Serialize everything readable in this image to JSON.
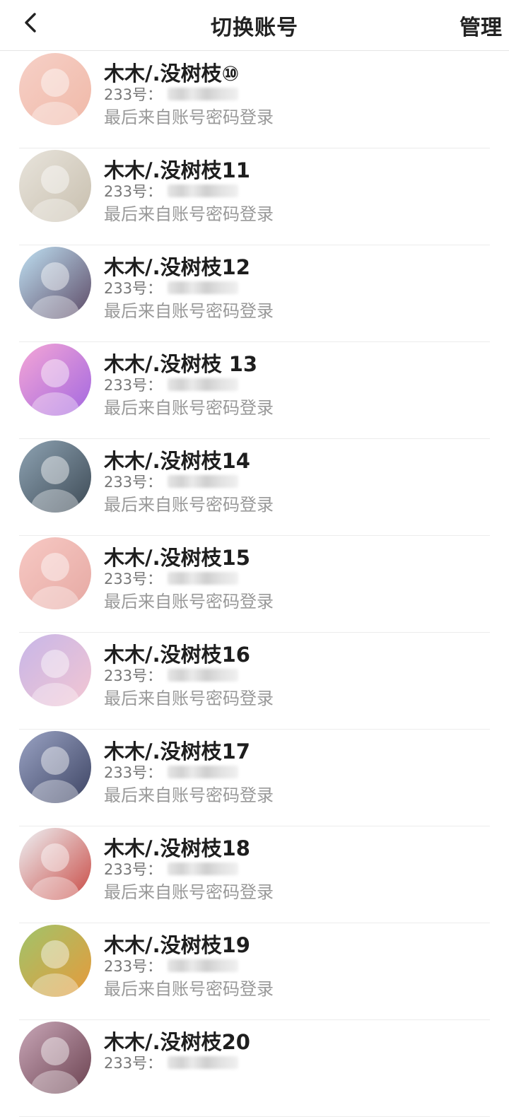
{
  "header": {
    "title": "切换账号",
    "manage_label": "管理",
    "back_icon": "chevron-left-icon"
  },
  "accounts": [
    {
      "name": "木木/.没树枝⑩",
      "id_label": "233号：",
      "login_info": "最后来自账号密码登录",
      "avatar_colors": [
        "#f6d0c7",
        "#f0b9a8"
      ]
    },
    {
      "name": "木木/.没树枝11",
      "id_label": "233号：",
      "login_info": "最后来自账号密码登录",
      "avatar_colors": [
        "#e8e4dc",
        "#c8bfae"
      ]
    },
    {
      "name": "木木/.没树枝12",
      "id_label": "233号：",
      "login_info": "最后来自账号密码登录",
      "avatar_colors": [
        "#bfe1f3",
        "#5d4a66"
      ]
    },
    {
      "name": "木木/.没树枝 13",
      "id_label": "233号：",
      "login_info": "最后来自账号密码登录",
      "avatar_colors": [
        "#f5a6d6",
        "#a368e0"
      ]
    },
    {
      "name": "木木/.没树枝14",
      "id_label": "233号：",
      "login_info": "最后来自账号密码登录",
      "avatar_colors": [
        "#8ea3b3",
        "#3d4a55"
      ]
    },
    {
      "name": "木木/.没树枝15",
      "id_label": "233号：",
      "login_info": "最后来自账号密码登录",
      "avatar_colors": [
        "#f7c9c4",
        "#e6a9a3"
      ]
    },
    {
      "name": "木木/.没树枝16",
      "id_label": "233号：",
      "login_info": "最后来自账号密码登录",
      "avatar_colors": [
        "#c7b6e8",
        "#f3c6d2"
      ]
    },
    {
      "name": "木木/.没树枝17",
      "id_label": "233号：",
      "login_info": "最后来自账号密码登录",
      "avatar_colors": [
        "#9aa3c4",
        "#3d4463"
      ]
    },
    {
      "name": "木木/.没树枝18",
      "id_label": "233号：",
      "login_info": "最后来自账号密码登录",
      "avatar_colors": [
        "#eef3f6",
        "#c94b45"
      ]
    },
    {
      "name": "木木/.没树枝19",
      "id_label": "233号：",
      "login_info": "最后来自账号密码登录",
      "avatar_colors": [
        "#9fc46b",
        "#e79a3b"
      ]
    },
    {
      "name": "木木/.没树枝20",
      "id_label": "233号：",
      "login_info": "",
      "avatar_colors": [
        "#c9a7b8",
        "#6b4250"
      ]
    }
  ]
}
